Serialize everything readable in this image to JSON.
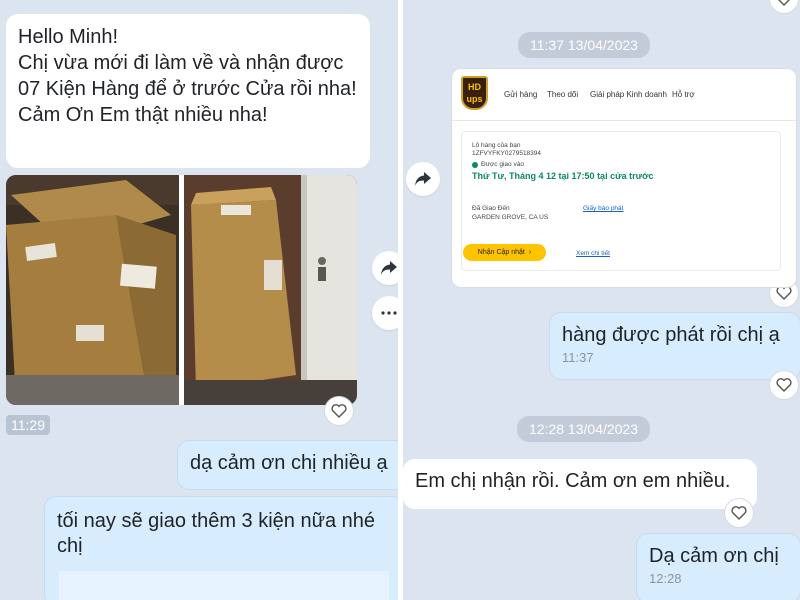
{
  "left": {
    "msg1": "Hello Minh!\nChị vừa mới đi làm về và nhận được 07 Kiện Hàng để ở trước Cửa rồi nha!\nCảm Ơn Em thật nhiều nha!",
    "photo_time": "11:29",
    "msg2": "dạ cảm ơn chị nhiều ạ",
    "msg3": "tối nay sẽ giao thêm 3 kiện nữa nhé chị"
  },
  "right": {
    "date1": "11:37 13/04/2023",
    "ups": {
      "logo_line1": "HD",
      "logo_line2": "ups",
      "nav": [
        "Gửi hàng",
        "Theo dõi",
        "Giải pháp Kinh doanh",
        "Hỗ trợ"
      ],
      "tracking_label": "Lô hàng của bạn",
      "tracking_number": "1ZFVYFKY0279518394",
      "delivered_label": "Được giao vào",
      "delivered_status": "Thứ Tư, Tháng 4 12 tại 17:50 tại cửa trước",
      "destination_label": "Đã Giao Đến",
      "destination_value": "GARDEN GROVE, CA US",
      "proof_link": "Giấy báo phát",
      "update_button": "Nhận Cập nhật",
      "details_link": "Xem chi tiết"
    },
    "msg1": "hàng được phát rồi chị ạ",
    "msg1_time": "11:37",
    "date2": "12:28 13/04/2023",
    "msg2": "Em chị nhận rồi. Cảm ơn em nhiều.",
    "msg3": "Dạ cảm ơn chị",
    "msg3_time": "12:28"
  },
  "icons": {
    "forward": "forward-arrow-icon",
    "more": "more-dots-icon",
    "like": "heart-icon"
  },
  "colors": {
    "chat_background": "#dbe4ef",
    "incoming_bubble": "#ffffff",
    "outgoing_bubble": "#d7ecfd",
    "ups_status_green": "#0b8b62",
    "ups_button_yellow": "#ffc400"
  }
}
